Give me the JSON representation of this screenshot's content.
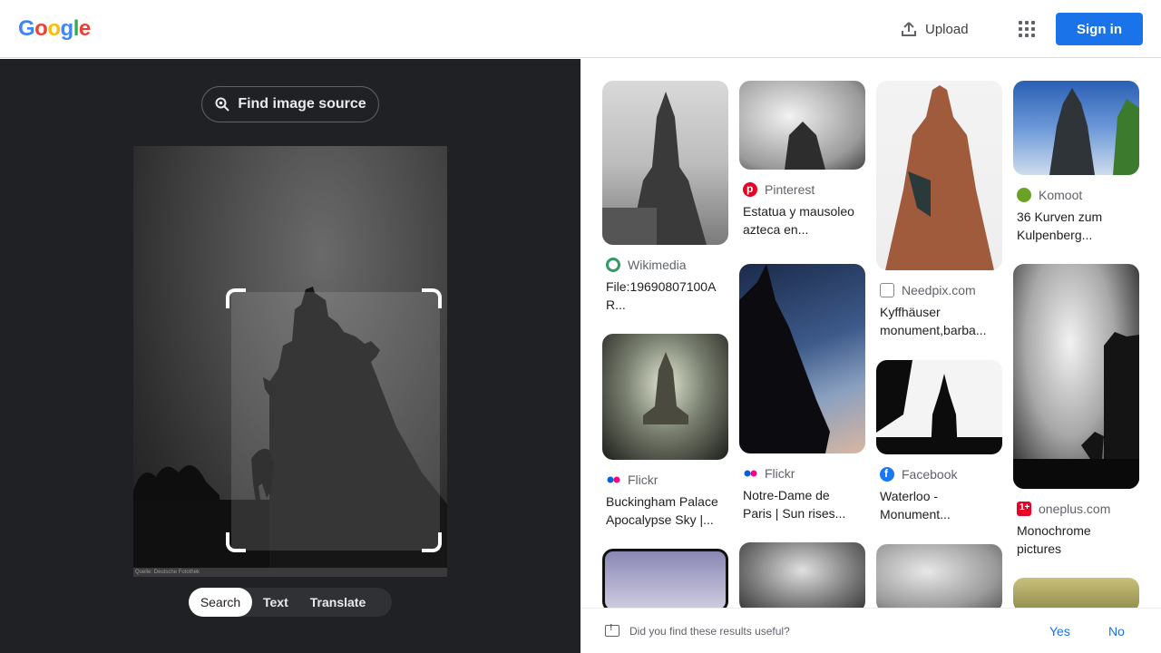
{
  "header": {
    "logo_letters": [
      "G",
      "o",
      "o",
      "g",
      "l",
      "e"
    ],
    "logo_colors": [
      "#4285F4",
      "#EA4335",
      "#FBBC05",
      "#4285F4",
      "#34A853",
      "#EA4335"
    ],
    "upload_label": "Upload",
    "signin_label": "Sign in"
  },
  "lens": {
    "find_source_label": "Find image source",
    "image_caption": "Quelle: Deutsche Fotothek",
    "modes": [
      "Search",
      "Text",
      "Translate"
    ],
    "active_mode": "Search"
  },
  "results": [
    {
      "source": "Wikimedia",
      "title_line1": "File:19690807100A",
      "title_line2": "R...",
      "icon": "wikimedia-icon"
    },
    {
      "source": "Flickr",
      "title_line1": "Buckingham Palace",
      "title_line2": "Apocalypse Sky |...",
      "icon": "flickr-icon"
    },
    {
      "source": "Pinterest",
      "title_line1": "Estatua y mausoleo",
      "title_line2": "azteca en...",
      "icon": "pinterest-icon"
    },
    {
      "source": "Flickr",
      "title_line1": "Notre-Dame de",
      "title_line2": "Paris | Sun rises...",
      "icon": "flickr-icon"
    },
    {
      "source": "Needpix.com",
      "title_line1": "Kyffhäuser",
      "title_line2": "monument,barba...",
      "icon": "needpix-icon"
    },
    {
      "source": "Facebook",
      "title_line1": "Waterloo -",
      "title_line2": "Monument...",
      "icon": "facebook-icon"
    },
    {
      "source": "Komoot",
      "title_line1": "36 Kurven zum",
      "title_line2": "Kulpenberg...",
      "icon": "komoot-icon"
    },
    {
      "source": "oneplus.com",
      "title_line1": "Monochrome",
      "title_line2": "pictures",
      "icon": "oneplus-icon"
    }
  ],
  "feedback": {
    "question": "Did you find these results useful?",
    "yes": "Yes",
    "no": "No"
  },
  "colors": {
    "accent": "#1a73e8",
    "dark_panel": "#202124"
  }
}
